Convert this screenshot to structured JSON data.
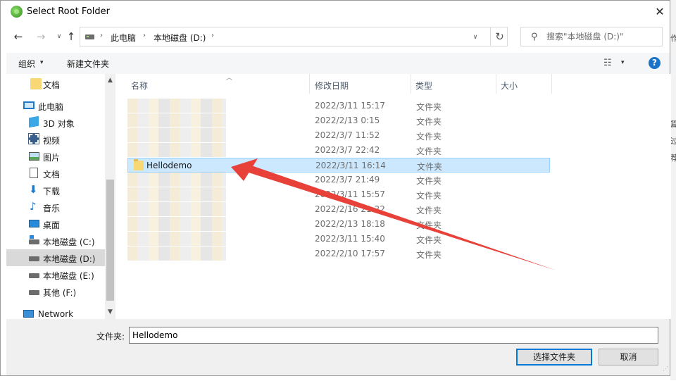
{
  "window": {
    "title": "Select Root Folder",
    "close": "✕"
  },
  "navigation": {
    "back": "←",
    "forward": "→",
    "recent": "∨",
    "up": "↑",
    "breadcrumb_sep": "›",
    "breadcrumbs": [
      "此电脑",
      "本地磁盘 (D:)"
    ],
    "dropdown": "∨",
    "refresh": "↻"
  },
  "search": {
    "icon": "⚲",
    "placeholder": "搜索\"本地磁盘 (D:)\""
  },
  "toolbar": {
    "organize": "组织",
    "organize_caret": "▾",
    "new_folder": "新建文件夹",
    "view_icon": "☷",
    "view_caret": "▾",
    "help": "?"
  },
  "nav_pane": {
    "items": [
      {
        "label": "文档",
        "icon": "folder"
      },
      {
        "label": "此电脑",
        "icon": "computer"
      },
      {
        "label": "3D 对象",
        "icon": "cube"
      },
      {
        "label": "视频",
        "icon": "video"
      },
      {
        "label": "图片",
        "icon": "pictures"
      },
      {
        "label": "文档",
        "icon": "document"
      },
      {
        "label": "下载",
        "icon": "download"
      },
      {
        "label": "音乐",
        "icon": "music"
      },
      {
        "label": "桌面",
        "icon": "desktop"
      },
      {
        "label": "本地磁盘 (C:)",
        "icon": "drive-c"
      },
      {
        "label": "本地磁盘 (D:)",
        "icon": "drive",
        "selected": true
      },
      {
        "label": "本地磁盘 (E:)",
        "icon": "drive"
      },
      {
        "label": "其他 (F:)",
        "icon": "drive"
      },
      {
        "label": "Network",
        "icon": "network"
      }
    ],
    "scroll_up": "▲",
    "scroll_down": "▼"
  },
  "file_list": {
    "columns": [
      "名称",
      "修改日期",
      "类型",
      "大小"
    ],
    "sort_caret": "︿",
    "rows": [
      {
        "name": "",
        "date": "2022/3/11 15:17",
        "type": "文件夹"
      },
      {
        "name": "",
        "date": "2022/2/13 0:15",
        "type": "文件夹"
      },
      {
        "name": "",
        "date": "2022/3/7 11:52",
        "type": "文件夹"
      },
      {
        "name": "",
        "date": "2022/3/7 22:42",
        "type": "文件夹"
      },
      {
        "name": "Hellodemo",
        "date": "2022/3/11 16:14",
        "type": "文件夹",
        "selected": true
      },
      {
        "name": "",
        "date": "2022/3/7 21:49",
        "type": "文件夹"
      },
      {
        "name": "",
        "date": "2022/3/11 15:57",
        "type": "文件夹"
      },
      {
        "name": "",
        "date": "2022/2/16 21:22",
        "type": "文件夹"
      },
      {
        "name": "",
        "date": "2022/2/13 18:18",
        "type": "文件夹"
      },
      {
        "name": "",
        "date": "2022/3/11 15:40",
        "type": "文件夹"
      },
      {
        "name": "",
        "date": "2022/2/10 17:57",
        "type": "文件夹"
      }
    ]
  },
  "bottom": {
    "folder_label": "文件夹:",
    "folder_value": "Hellodemo",
    "select_button": "选择文件夹",
    "cancel_button": "取消"
  },
  "background_app": {
    "fragments": [
      "作",
      "篇",
      "过",
      "荐"
    ]
  },
  "colors": {
    "selection": "#cce8ff",
    "selection_border": "#99d1ff",
    "arrow": "#e8413a",
    "accent": "#0078d7"
  }
}
